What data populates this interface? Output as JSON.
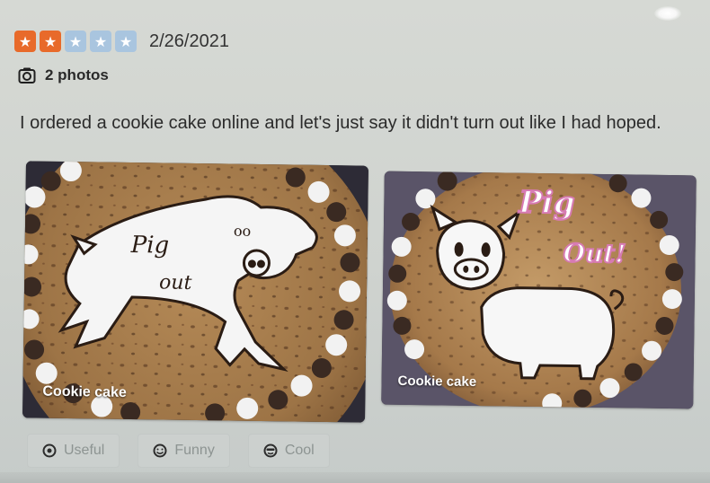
{
  "review": {
    "rating": 2,
    "rating_max": 5,
    "date": "2/26/2021",
    "photo_count_label": "2 photos",
    "text": "I ordered a cookie cake online and let's just say it didn't turn out like I had hoped."
  },
  "photos": [
    {
      "caption": "Cookie cake",
      "writing_line1": "Pig",
      "writing_line2": "out"
    },
    {
      "caption": "Cookie cake",
      "writing_line1": "Pig",
      "writing_line2": "Out!"
    }
  ],
  "actions": {
    "useful_label": "Useful",
    "funny_label": "Funny",
    "cool_label": "Cool"
  },
  "colors": {
    "star_filled": "#e86a2a",
    "star_empty": "#a9c5df",
    "cookie": "#a27847",
    "frosting_dark": "#3a2a22"
  },
  "icons": {
    "camera": "camera-icon",
    "star": "star-icon",
    "useful": "useful-icon",
    "funny": "funny-icon",
    "cool": "cool-icon"
  }
}
